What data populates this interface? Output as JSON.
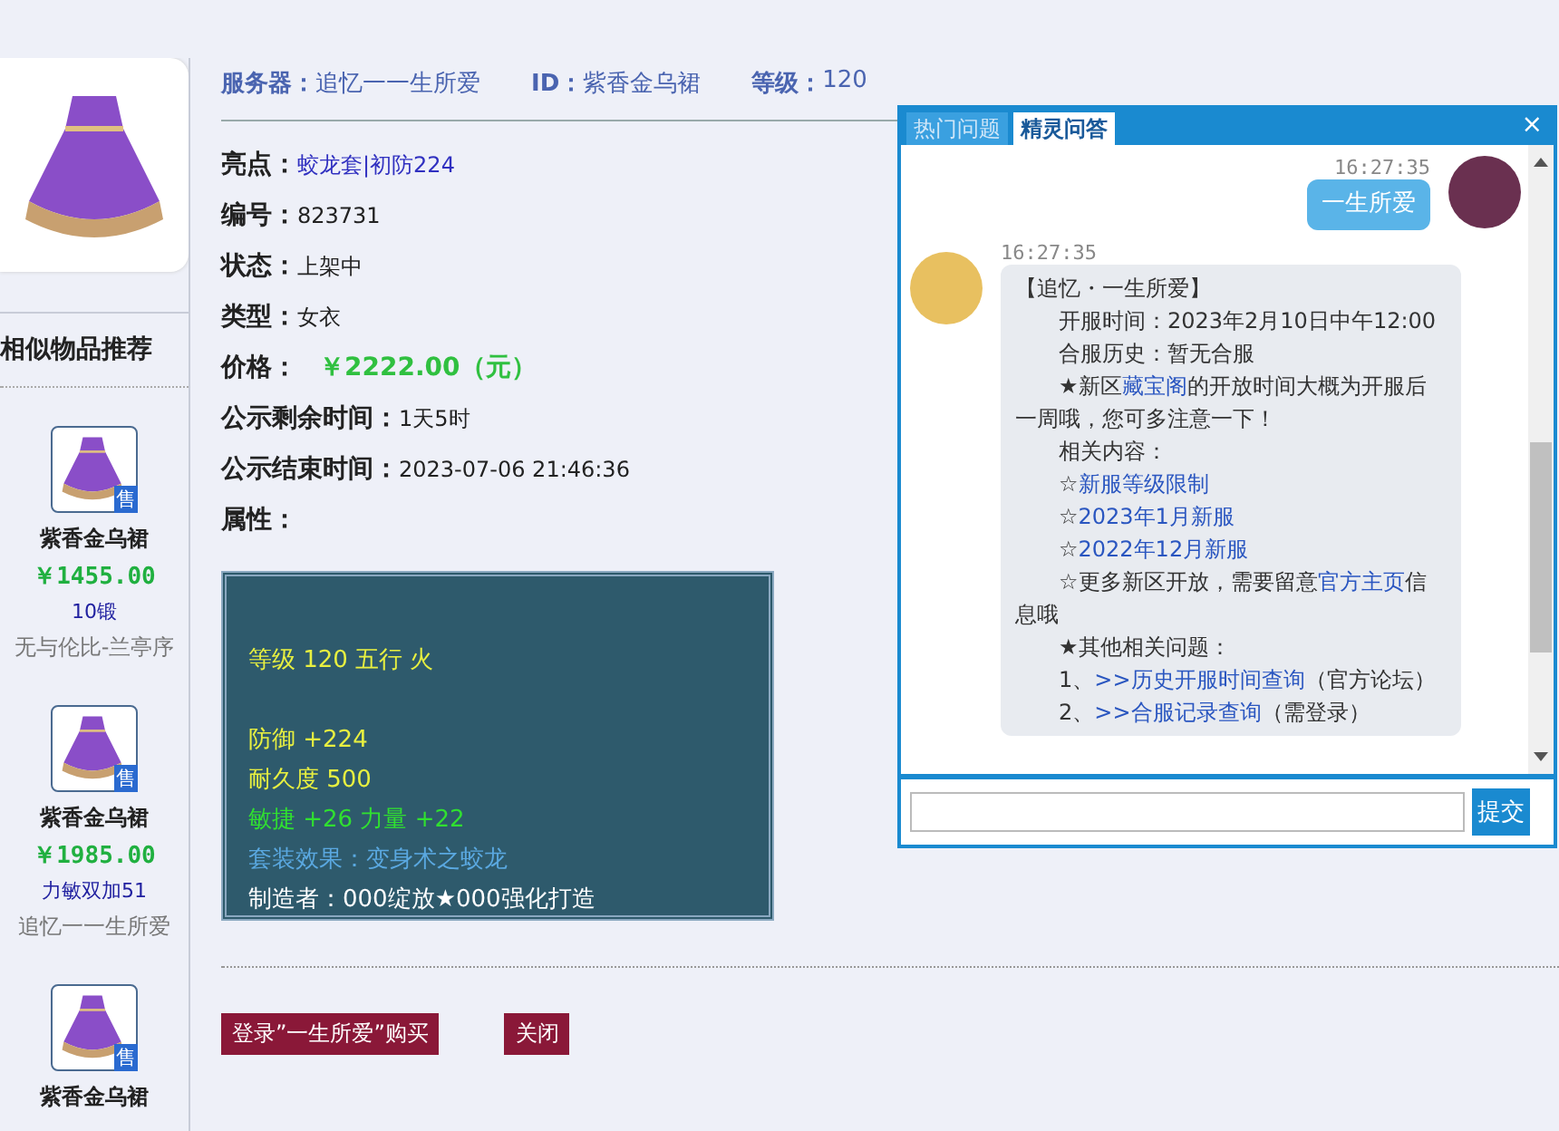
{
  "sidebar": {
    "title": "相似物品推荐",
    "items": [
      {
        "name": "紫香金乌裙",
        "badge": "售",
        "price": "￥1455.00",
        "note": "10锻",
        "seller": "无与伦比-兰亭序"
      },
      {
        "name": "紫香金乌裙",
        "badge": "售",
        "price": "￥1985.00",
        "note": "力敏双加51",
        "seller": "追忆一一生所爱"
      },
      {
        "name": "紫香金乌裙",
        "badge": "售"
      }
    ]
  },
  "header": [
    {
      "label": "服务器：",
      "value": "追忆一一生所爱"
    },
    {
      "label": "ID：",
      "value": "紫香金乌裙"
    },
    {
      "label": "等级：",
      "value": "120"
    }
  ],
  "details": [
    {
      "label": "亮点：",
      "value": "蛟龙套|初防224",
      "kind": "link"
    },
    {
      "label": "编号：",
      "value": "823731",
      "kind": "plain"
    },
    {
      "label": "状态：",
      "value": "上架中",
      "kind": "plain"
    },
    {
      "label": "类型：",
      "value": "女衣",
      "kind": "plain"
    },
    {
      "label": "价格：",
      "value": "￥2222.00（元）",
      "kind": "price"
    },
    {
      "label": "公示剩余时间：",
      "value": "1天5时",
      "kind": "plain"
    },
    {
      "label": "公示结束时间：",
      "value": "2023-07-06 21:46:36",
      "kind": "plain"
    },
    {
      "label": "属性："
    }
  ],
  "attribute_groups": [
    [
      {
        "text": "等级 120 五行 火",
        "color": "#e8f040"
      }
    ],
    [
      {
        "text": "防御 +224",
        "color": "#e8f040"
      },
      {
        "text": "耐久度 500",
        "color": "#e8f040"
      },
      {
        "text": "敏捷 +26 力量 +22",
        "color": "#30e030"
      },
      {
        "text": "套装效果：变身术之蛟龙",
        "color": "#5aa8e0"
      },
      {
        "text": "制造者：000绽放★000强化打造",
        "color": "#ffffff"
      }
    ]
  ],
  "buttons": [
    "登录”一生所爱”购买",
    "关闭"
  ],
  "chat": {
    "tabs": [
      {
        "label": "热门问题",
        "selected": false
      },
      {
        "label": "精灵问答",
        "selected": true
      }
    ],
    "close": "×",
    "messages": [
      {
        "kind": "outgoing",
        "time": "16:27:35",
        "paragraphs": [
          {
            "indent": false,
            "parts": [
              {
                "kind": "text",
                "text": "一生所爱"
              }
            ]
          }
        ]
      },
      {
        "kind": "incoming",
        "time": "16:27:35",
        "paragraphs": [
          {
            "indent": false,
            "parts": [
              {
                "kind": "text",
                "text": "【追忆・一生所爱】"
              }
            ]
          },
          {
            "indent": true,
            "parts": [
              {
                "kind": "text",
                "text": "开服时间：2023年2月10日中午12:00"
              }
            ]
          },
          {
            "indent": true,
            "parts": [
              {
                "kind": "text",
                "text": "合服历史：暂无合服"
              }
            ]
          },
          {
            "indent": true,
            "parts": [
              {
                "kind": "text",
                "text": "★新区"
              },
              {
                "kind": "link",
                "text": "藏宝阁"
              },
              {
                "kind": "text",
                "text": "的开放时间大概为开服后一周哦，您可多注意一下！"
              }
            ]
          },
          {
            "indent": true,
            "parts": [
              {
                "kind": "text",
                "text": "相关内容："
              }
            ]
          },
          {
            "indent": true,
            "parts": [
              {
                "kind": "text",
                "text": "☆"
              },
              {
                "kind": "link",
                "text": "新服等级限制"
              }
            ]
          },
          {
            "indent": true,
            "parts": [
              {
                "kind": "text",
                "text": "☆"
              },
              {
                "kind": "link",
                "text": "2023年1月新服"
              }
            ]
          },
          {
            "indent": true,
            "parts": [
              {
                "kind": "text",
                "text": "☆"
              },
              {
                "kind": "link",
                "text": "2022年12月新服"
              }
            ]
          },
          {
            "indent": true,
            "parts": [
              {
                "kind": "text",
                "text": "☆更多新区开放，需要留意"
              },
              {
                "kind": "link",
                "text": "官方主页"
              },
              {
                "kind": "text",
                "text": "信息哦"
              }
            ]
          },
          {
            "indent": true,
            "parts": [
              {
                "kind": "text",
                "text": "★其他相关问题："
              }
            ]
          },
          {
            "indent": true,
            "parts": [
              {
                "kind": "text",
                "text": "1、"
              },
              {
                "kind": "link",
                "text": ">>历史开服时间查询"
              },
              {
                "kind": "text",
                "text": "（官方论坛）"
              }
            ]
          },
          {
            "indent": true,
            "parts": [
              {
                "kind": "text",
                "text": "2、"
              },
              {
                "kind": "link",
                "text": ">>合服记录查询"
              },
              {
                "kind": "text",
                "text": "（需登录）"
              }
            ]
          }
        ]
      }
    ],
    "submit": "提交"
  }
}
